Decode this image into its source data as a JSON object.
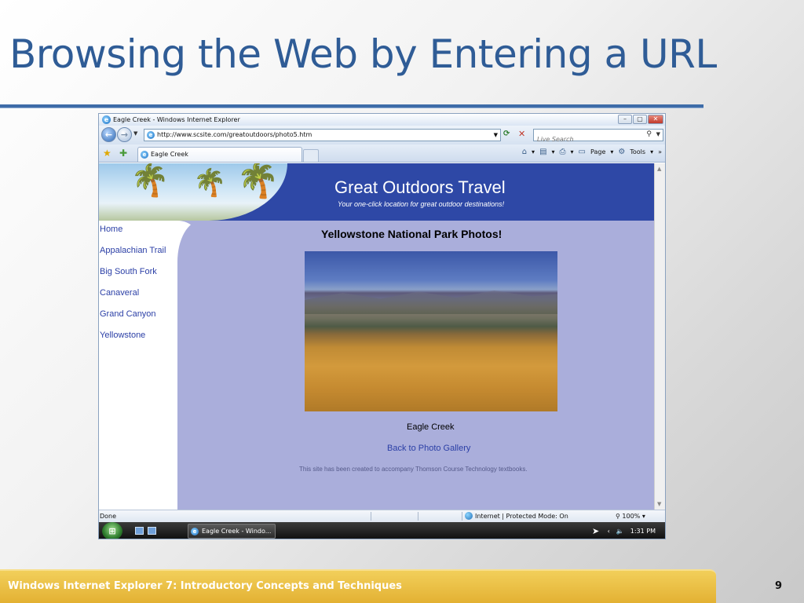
{
  "slide": {
    "title": "Browsing the Web by Entering a URL",
    "footer": "Windows Internet Explorer 7: Introductory Concepts and Techniques",
    "page_number": "9"
  },
  "browser": {
    "window_title": "Eagle Creek - Windows Internet Explorer",
    "address": "http://www.scsite.com/greatoutdoors/photo5.htm",
    "search_placeholder": "Live Search",
    "tab_label": "Eagle Creek",
    "commands": {
      "page": "Page",
      "tools": "Tools"
    },
    "status": {
      "left": "Done",
      "zone": "Internet | Protected Mode: On",
      "zoom": "100%"
    },
    "taskbar": {
      "task": "Eagle Creek - Windo...",
      "clock": "1:31 PM"
    }
  },
  "site": {
    "title": "Great Outdoors Travel",
    "tagline": "Your one-click location for great outdoor destinations!",
    "nav": [
      "Home",
      "Appalachian Trail",
      "Big South Fork",
      "Canaveral",
      "Grand Canyon",
      "Yellowstone"
    ],
    "heading": "Yellowstone National Park Photos!",
    "photo_caption": "Eagle Creek",
    "back_link": "Back to Photo Gallery",
    "note": "This site has been created to accompany Thomson Course Technology textbooks."
  },
  "colors": {
    "slide_title": "#2f5c96",
    "site_banner": "#2e48a6",
    "content_bg": "#aaaedb",
    "link": "#2b3fa6",
    "footer": "#e3b133"
  }
}
